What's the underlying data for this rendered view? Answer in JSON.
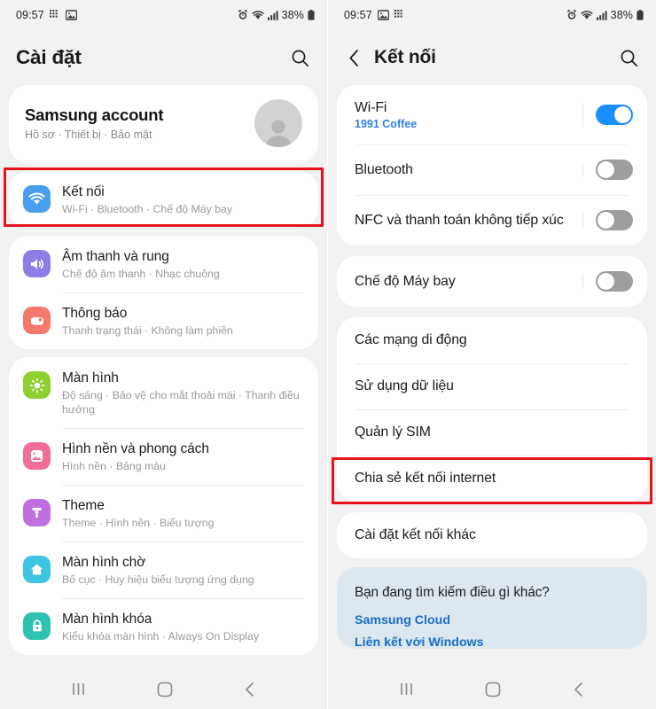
{
  "status_bar": {
    "time": "09:57",
    "battery": "38%",
    "icons_left": [
      "app-grid-icon",
      "image-icon"
    ],
    "icons_right": [
      "alarm-icon",
      "wifi-icon",
      "signal-icon"
    ]
  },
  "left_screen": {
    "app_bar": {
      "title": "Cài đặt",
      "search_icon": "search-icon"
    },
    "account": {
      "title": "Samsung account",
      "subtitle": "Hồ sơ  ·  Thiết bị  ·  Bảo mật",
      "avatar_icon": "person-icon"
    },
    "groups": [
      {
        "highlighted": true,
        "items": [
          {
            "title": "Kết nối",
            "subtitle": "Wi-Fi  ·  Bluetooth  ·  Chế độ Máy bay",
            "icon": "wifi-icon",
            "icon_color": "#4a9ef0"
          }
        ]
      },
      {
        "highlighted": false,
        "items": [
          {
            "title": "Âm thanh và rung",
            "subtitle": "Chế độ âm thanh  ·  Nhạc chuông",
            "icon": "speaker-icon",
            "icon_color": "#8e7ce8"
          },
          {
            "title": "Thông báo",
            "subtitle": "Thanh trạng thái  ·  Không làm phiền",
            "icon": "notification-icon",
            "icon_color": "#f4786b"
          }
        ]
      },
      {
        "highlighted": false,
        "items": [
          {
            "title": "Màn hình",
            "subtitle": "Độ sáng  ·  Bảo vệ cho mắt thoải mái  ·  Thanh điều hướng",
            "icon": "brightness-icon",
            "icon_color": "#8ed030"
          },
          {
            "title": "Hình nền và phong cách",
            "subtitle": "Hình nền  ·  Bảng màu",
            "icon": "wallpaper-icon",
            "icon_color": "#ef6f96"
          },
          {
            "title": "Theme",
            "subtitle": "Theme  ·  Hình nền  ·  Biểu tượng",
            "icon": "brush-icon",
            "icon_color": "#c06fe0"
          },
          {
            "title": "Màn hình chờ",
            "subtitle": "Bố cục  ·  Huy hiệu biểu tượng ứng dụng",
            "icon": "home-icon",
            "icon_color": "#3ec4e0"
          },
          {
            "title": "Màn hình khóa",
            "subtitle": "Kiểu khóa màn hình  ·  Always On Display",
            "icon": "lock-icon",
            "icon_color": "#2ec2b0"
          }
        ]
      }
    ]
  },
  "right_screen": {
    "app_bar": {
      "title": "Kết nối",
      "back_icon": "chevron-left-icon",
      "search_icon": "search-icon"
    },
    "toggle_group": [
      {
        "title": "Wi-Fi",
        "subtitle": "1991 Coffee",
        "toggle": "on"
      },
      {
        "title": "Bluetooth",
        "subtitle": "",
        "toggle": "off"
      },
      {
        "title": "NFC và thanh toán không tiếp xúc",
        "subtitle": "",
        "toggle": "off"
      }
    ],
    "airplane_group": [
      {
        "title": "Chế độ Máy bay",
        "toggle": "off"
      }
    ],
    "links_group": [
      {
        "title": "Các mạng di động",
        "highlighted": false
      },
      {
        "title": "Sử dụng dữ liệu",
        "highlighted": false
      },
      {
        "title": "Quản lý SIM",
        "highlighted": false
      },
      {
        "title": "Chia sẻ kết nối internet",
        "highlighted": true
      }
    ],
    "other_group": [
      {
        "title": "Cài đặt kết nối khác"
      }
    ],
    "tips": {
      "question": "Bạn đang tìm kiếm điều gì khác?",
      "link1": "Samsung Cloud",
      "link2": "Liên kết với Windows"
    }
  },
  "nav_bar": {
    "recents_icon": "recents-icon",
    "home_icon": "home-square-icon",
    "back_icon": "back-chevron-icon"
  },
  "colors": {
    "highlight": "#e8131a",
    "accent_blue": "#1a8fff",
    "link_blue": "#1b6fc4",
    "tips_bg": "#dce7f0"
  }
}
